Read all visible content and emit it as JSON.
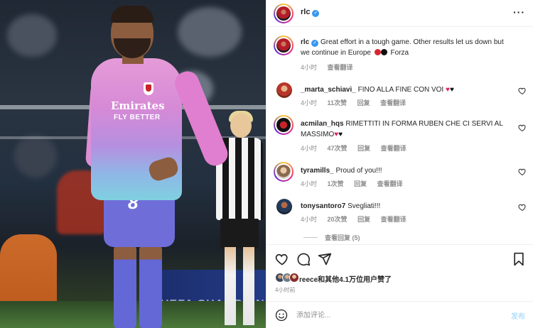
{
  "post_header": {
    "username": "rlc",
    "verified_badge": "✓",
    "more_icon": "more-horizontal-icon"
  },
  "photo": {
    "sponsor_line1": "Emirates",
    "sponsor_line2": "FLY BETTER",
    "shirt_number": "8",
    "board_text": "UEFA CHAMPIONS L"
  },
  "caption": {
    "username": "rlc",
    "text": "Great effort in a tough game. Other results let us down but we continue in Europe",
    "text_end": "Forza",
    "time": "4小时",
    "translate": "查看翻译"
  },
  "comments": [
    {
      "username": "_marta_schiavi_",
      "text": "FINO ALLA FINE CON VOI",
      "time": "4小时",
      "likes": "11次赞",
      "reply": "回复",
      "translate": "查看翻译"
    },
    {
      "username": "acmilan_hqs",
      "text": "RIMETTITI IN FORMA RUBEN CHE CI SERVI AL MASSIMO",
      "time": "4小时",
      "likes": "47次赞",
      "reply": "回复",
      "translate": "查看翻译"
    },
    {
      "username": "tyramills_",
      "text": "Proud of you!!!",
      "time": "4小时",
      "likes": "1次赞",
      "reply": "回复",
      "translate": "查看翻译"
    },
    {
      "username": "tonysantoro7",
      "text": "Svegliati!!!",
      "time": "4小时",
      "likes": "20次赞",
      "reply": "回复",
      "translate": "查看翻译"
    }
  ],
  "view_replies": "查看回复 (5)",
  "actions": {
    "like_icon": "heart-icon",
    "comment_icon": "comment-icon",
    "share_icon": "send-icon",
    "save_icon": "bookmark-icon"
  },
  "likes_summary": "reece和其他4.1万位用户赞了",
  "post_time": "4小时前",
  "comment_box": {
    "placeholder": "添加评论...",
    "post_label": "发布",
    "emoji_icon": "smiley-icon"
  },
  "colors": {
    "verified": "#3897f0",
    "meta_gray": "#8e8e8e",
    "post_button_disabled": "#b2dffc",
    "heart_red": "#e0245e"
  }
}
